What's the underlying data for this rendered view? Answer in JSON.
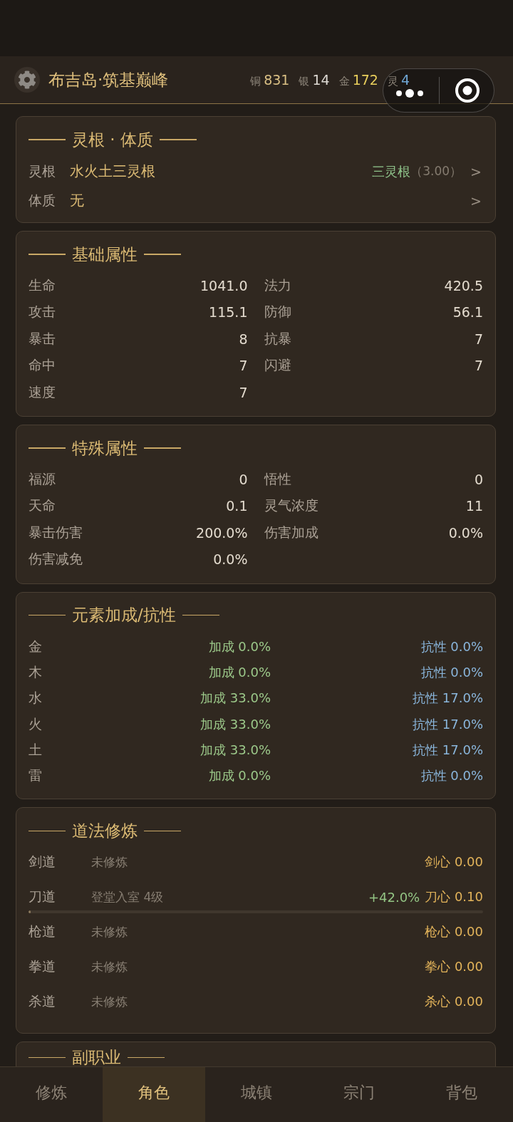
{
  "header": {
    "title": "布吉岛·筑基巅峰",
    "currencies": [
      {
        "label": "铜",
        "value": "831",
        "color": "#d9bf84"
      },
      {
        "label": "银",
        "value": "14",
        "color": "#dedad4"
      },
      {
        "label": "金",
        "value": "172",
        "color": "#e9cf5c"
      },
      {
        "label": "灵",
        "value": "4",
        "color": "#6fa6d4"
      }
    ]
  },
  "sections": [
    {
      "kind": "root",
      "title": "灵根 · 体质",
      "rows": [
        {
          "label": "灵根",
          "value": "水火土三灵根",
          "grade": "三灵根",
          "score": "（3.00）",
          "chevron": ">"
        },
        {
          "label": "体质",
          "value": "无",
          "chevron": ">"
        }
      ]
    },
    {
      "kind": "stats",
      "title": "基础属性",
      "items": [
        {
          "label": "生命",
          "value": "1041.0"
        },
        {
          "label": "法力",
          "value": "420.5"
        },
        {
          "label": "攻击",
          "value": "115.1"
        },
        {
          "label": "防御",
          "value": "56.1"
        },
        {
          "label": "暴击",
          "value": "8"
        },
        {
          "label": "抗暴",
          "value": "7"
        },
        {
          "label": "命中",
          "value": "7"
        },
        {
          "label": "闪避",
          "value": "7"
        },
        {
          "label": "速度",
          "value": "7"
        }
      ]
    },
    {
      "kind": "stats",
      "title": "特殊属性",
      "items": [
        {
          "label": "福源",
          "value": "0"
        },
        {
          "label": "悟性",
          "value": "0"
        },
        {
          "label": "天命",
          "value": "0.1"
        },
        {
          "label": "灵气浓度",
          "value": "11"
        },
        {
          "label": "暴击伤害",
          "value": "200.0%"
        },
        {
          "label": "伤害加成",
          "value": "0.0%"
        },
        {
          "label": "伤害减免",
          "value": "0.0%"
        }
      ]
    },
    {
      "kind": "elements",
      "title": "元素加成/抗性",
      "rows": [
        {
          "label": "金",
          "bonus": "加成 0.0%",
          "resist": "抗性 0.0%"
        },
        {
          "label": "木",
          "bonus": "加成 0.0%",
          "resist": "抗性 0.0%"
        },
        {
          "label": "水",
          "bonus": "加成 33.0%",
          "resist": "抗性 17.0%"
        },
        {
          "label": "火",
          "bonus": "加成 33.0%",
          "resist": "抗性 17.0%"
        },
        {
          "label": "土",
          "bonus": "加成 33.0%",
          "resist": "抗性 17.0%"
        },
        {
          "label": "雷",
          "bonus": "加成 0.0%",
          "resist": "抗性 0.0%"
        }
      ]
    },
    {
      "kind": "dao",
      "title": "道法修炼",
      "rows": [
        {
          "label": "剑道",
          "status": "未修炼",
          "heart": "剑心 0.00"
        },
        {
          "label": "刀道",
          "status": "登堂入室 4级",
          "boost": "+42.0%",
          "heart": "刀心 0.10",
          "level": 0.005
        },
        {
          "label": "枪道",
          "status": "未修炼",
          "heart": "枪心 0.00"
        },
        {
          "label": "拳道",
          "status": "未修炼",
          "heart": "拳心 0.00"
        },
        {
          "label": "杀道",
          "status": "未修炼",
          "heart": "杀心 0.00"
        }
      ]
    },
    {
      "kind": "other",
      "title": "副职业"
    }
  ],
  "tabs": [
    {
      "label": "修炼",
      "selected": false
    },
    {
      "label": "角色",
      "selected": true
    },
    {
      "label": "城镇",
      "selected": false
    },
    {
      "label": "宗门",
      "selected": false
    },
    {
      "label": "背包",
      "selected": false
    }
  ]
}
